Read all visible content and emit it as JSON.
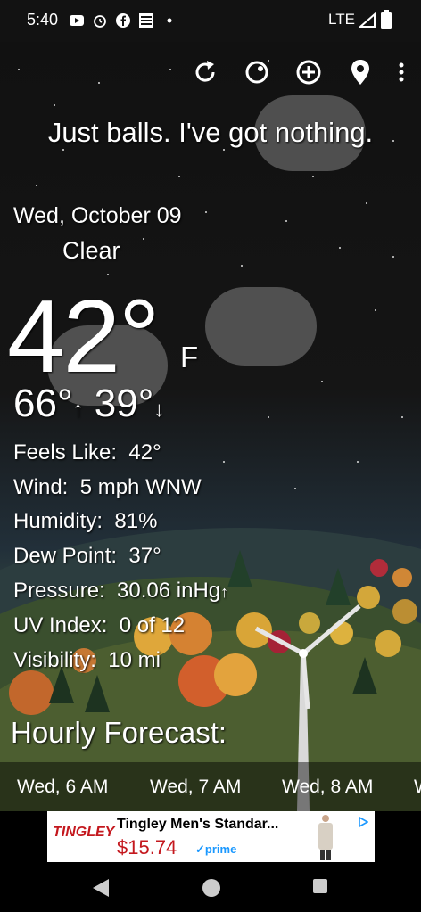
{
  "status_bar": {
    "time": "5:40",
    "network": "LTE"
  },
  "toolbar": {
    "icons": [
      "refresh-icon",
      "theme-icon",
      "add-location-icon",
      "location-pin-icon",
      "more-icon"
    ]
  },
  "tagline": "Just balls. I've got nothing.",
  "current": {
    "date": "Wed, October 09",
    "condition": "Clear",
    "temperature": "42°",
    "unit": "F",
    "high": "66°",
    "low": "39°"
  },
  "details": [
    {
      "label": "Feels Like:",
      "value": "42°"
    },
    {
      "label": "Wind:",
      "value": "5 mph WNW"
    },
    {
      "label": "Humidity:",
      "value": "81%"
    },
    {
      "label": "Dew Point:",
      "value": "37°"
    },
    {
      "label": "Pressure:",
      "value": "30.06 inHg"
    },
    {
      "label": "UV Index:",
      "value": "0 of 12"
    },
    {
      "label": "Visibility:",
      "value": "10 mi"
    }
  ],
  "hourly": {
    "title": "Hourly Forecast:",
    "hours": [
      "Wed, 6 AM",
      "Wed, 7 AM",
      "Wed, 8 AM",
      "W"
    ]
  },
  "ad": {
    "brand": "TINGLEY",
    "title": "Tingley Men's Standar...",
    "price": "$15.74",
    "prime": "✓prime"
  }
}
